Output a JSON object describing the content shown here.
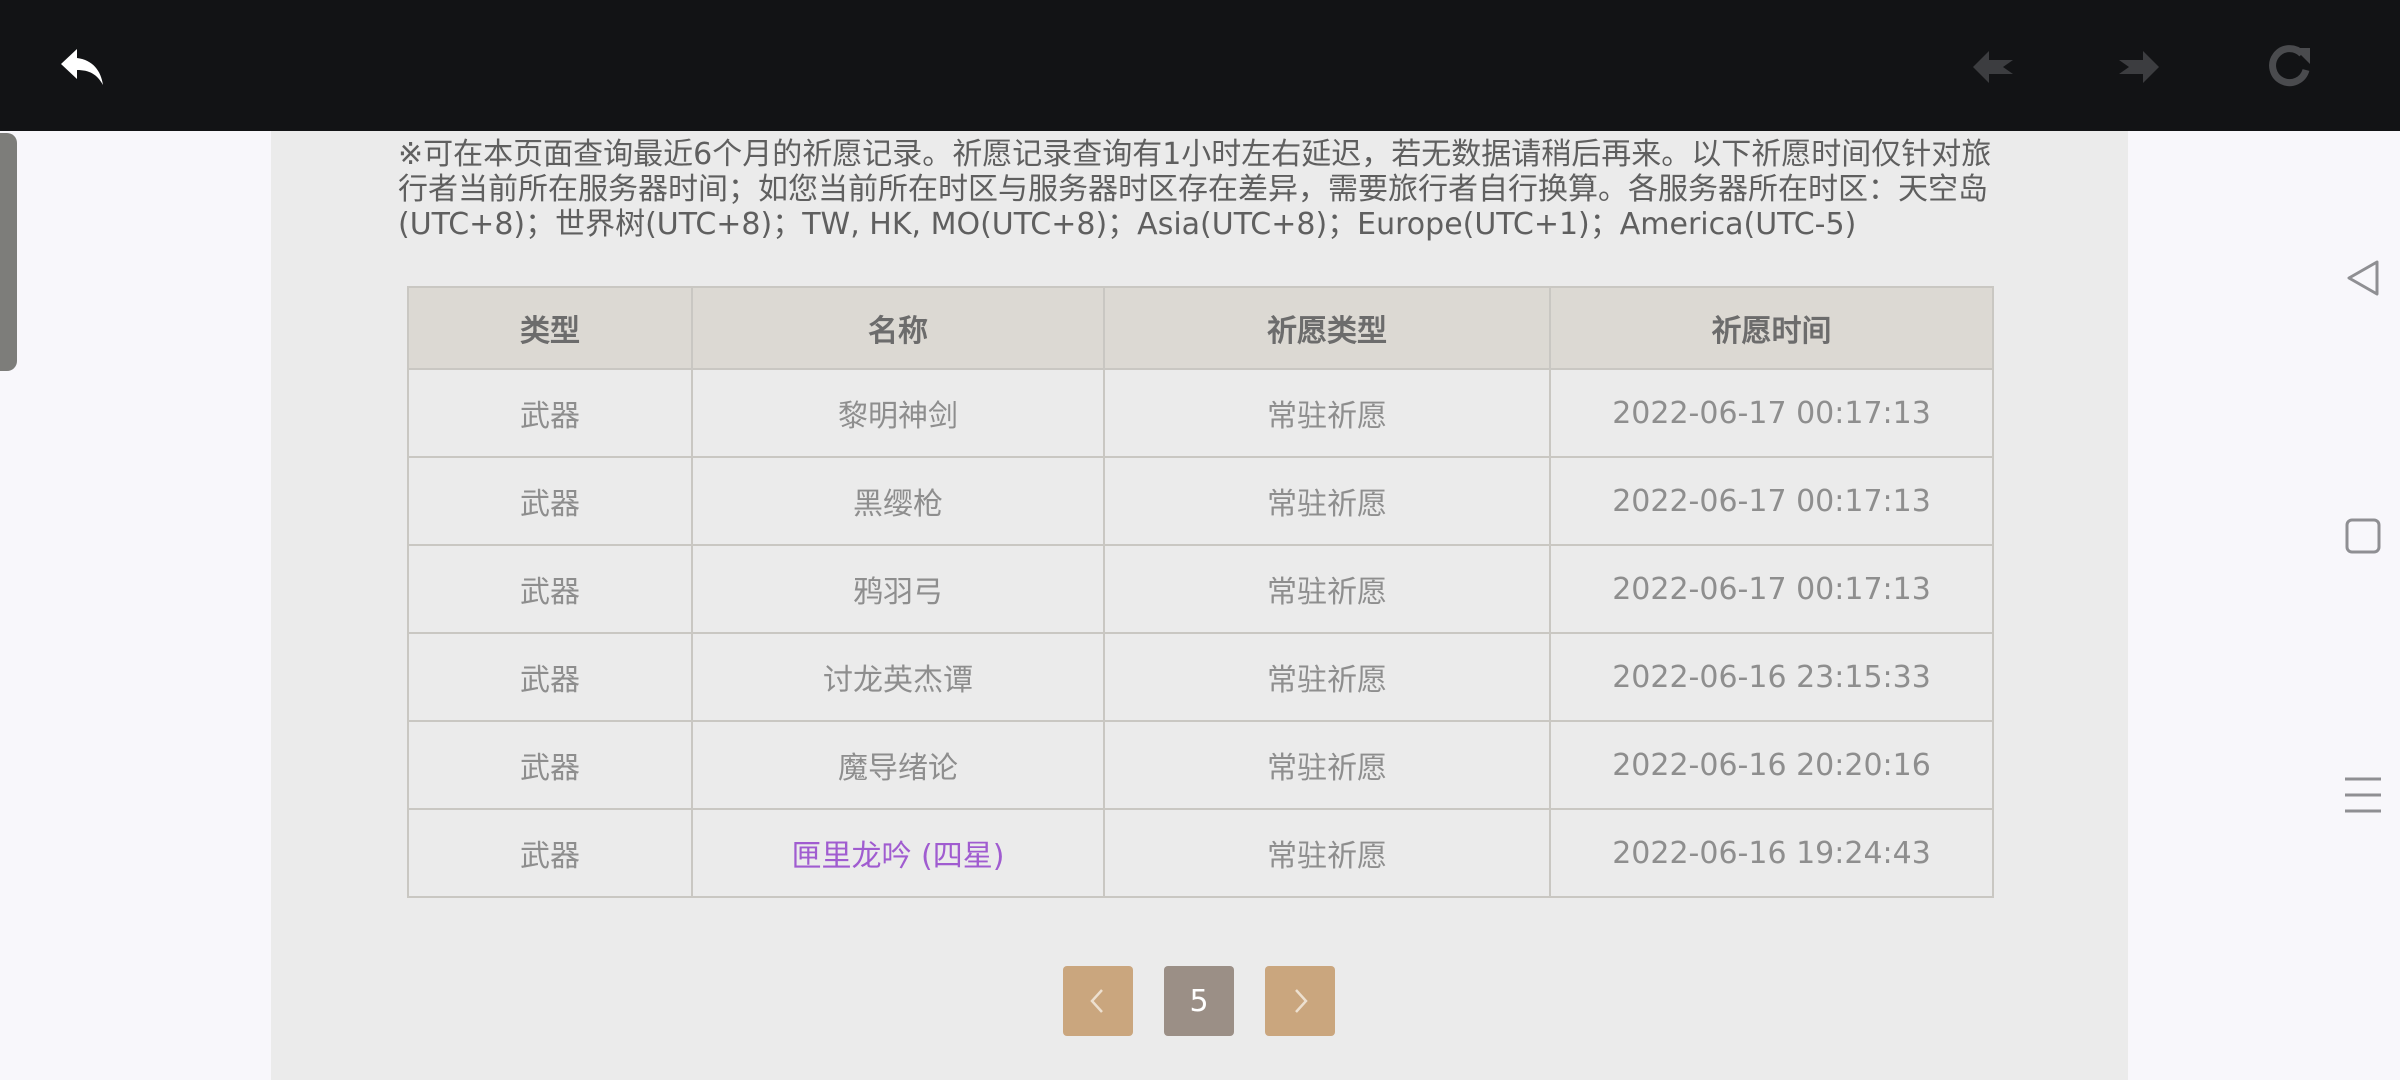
{
  "toolbar": {
    "back_icon": "back-arrow-icon",
    "prev_icon": "page-back-icon",
    "next_icon": "page-forward-icon",
    "reload_icon": "reload-icon"
  },
  "notice": "※可在本页面查询最近6个月的祈愿记录。祈愿记录查询有1小时左右延迟，若无数据请稍后再来。以下祈愿时间仅针对旅行者当前所在服务器时间；如您当前所在时区与服务器时区存在差异，需要旅行者自行换算。各服务器所在时区：天空岛(UTC+8)；世界树(UTC+8)；TW, HK, MO(UTC+8)；Asia(UTC+8)；Europe(UTC+1)；America(UTC-5)",
  "table": {
    "headers": [
      "类型",
      "名称",
      "祈愿类型",
      "祈愿时间"
    ],
    "rows": [
      {
        "type": "武器",
        "name": "黎明神剑",
        "wish_type": "常驻祈愿",
        "time": "2022-06-17 00:17:13"
      },
      {
        "type": "武器",
        "name": "黑缨枪",
        "wish_type": "常驻祈愿",
        "time": "2022-06-17 00:17:13"
      },
      {
        "type": "武器",
        "name": "鸦羽弓",
        "wish_type": "常驻祈愿",
        "time": "2022-06-17 00:17:13"
      },
      {
        "type": "武器",
        "name": "讨龙英杰谭",
        "wish_type": "常驻祈愿",
        "time": "2022-06-16 23:15:33"
      },
      {
        "type": "武器",
        "name": "魔导绪论",
        "wish_type": "常驻祈愿",
        "time": "2022-06-16 20:20:16"
      },
      {
        "type": "武器",
        "name": "匣里龙吟 (四星)",
        "wish_type": "常驻祈愿",
        "time": "2022-06-16 19:24:43"
      }
    ]
  },
  "pager": {
    "current_page": "5"
  },
  "colors": {
    "topbar": "#121315",
    "panel": "#ebebeb",
    "header_bg": "#dcd9d3",
    "four_star": "#a05cd0",
    "pager_arrow": "#caa67e",
    "pager_current": "#9b8f86"
  }
}
